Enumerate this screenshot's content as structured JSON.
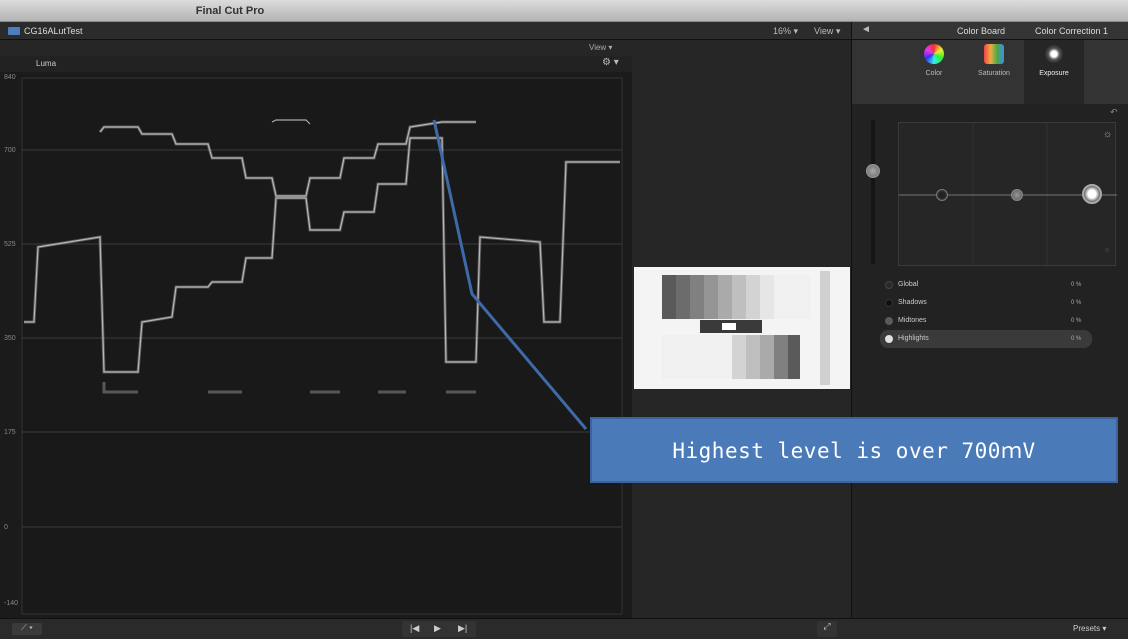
{
  "app": {
    "title": "Final Cut Pro"
  },
  "viewer": {
    "clip_name": "CG16ALutTest",
    "zoom": "16%",
    "view_label": "View"
  },
  "scope": {
    "view_label": "View",
    "type_label": "Luma",
    "axis_labels": [
      "840",
      "700",
      "525",
      "350",
      "175",
      "0",
      "-140"
    ]
  },
  "inspector": {
    "title": "Color Board",
    "correction": "Color Correction 1",
    "tabs": [
      {
        "label": "Color",
        "active": false
      },
      {
        "label": "Saturation",
        "active": false
      },
      {
        "label": "Exposure",
        "active": true
      }
    ],
    "rows": [
      {
        "label": "Global",
        "value": "0 %",
        "dot_color": "#2a2a2a"
      },
      {
        "label": "Shadows",
        "value": "0 %",
        "dot_color": "#111111"
      },
      {
        "label": "Midtones",
        "value": "0 %",
        "dot_color": "#5a5a5a"
      },
      {
        "label": "Highlights",
        "value": "0 %",
        "dot_color": "#e0e0e0"
      }
    ]
  },
  "bottombar": {
    "presets_label": "Presets"
  },
  "annotation": {
    "text": "Highest level is over 700ｍV"
  }
}
